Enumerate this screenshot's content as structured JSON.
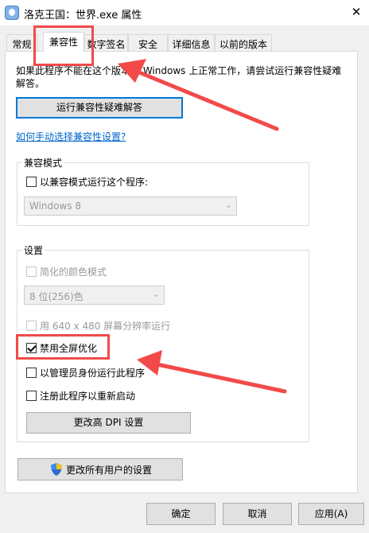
{
  "window": {
    "title": "洛克王国：世界.exe 属性",
    "close_glyph": "✕"
  },
  "tabs": [
    {
      "label": "常规"
    },
    {
      "label": "兼容性"
    },
    {
      "label": "数字签名"
    },
    {
      "label": "安全"
    },
    {
      "label": "详细信息"
    },
    {
      "label": "以前的版本"
    }
  ],
  "compat": {
    "description": "如果此程序不能在这个版本的 Windows 上正常工作，请尝试运行兼容性疑难解答。",
    "troubleshoot_button": "运行兼容性疑难解答",
    "manual_link": "如何手动选择兼容性设置?",
    "mode_group": {
      "label": "兼容模式",
      "checkbox_label": "以兼容模式运行这个程序:",
      "checked": false,
      "os_select_value": "Windows 8"
    },
    "settings_group": {
      "label": "设置",
      "reduced_color": {
        "label": "简化的颜色模式",
        "checked": false,
        "disabled": true
      },
      "color_select_value": "8 位(256)色",
      "res_640": {
        "label": "用 640 x 480 屏幕分辨率运行",
        "checked": false,
        "disabled": true
      },
      "disable_fullscreen": {
        "label": "禁用全屏优化",
        "checked": true
      },
      "run_as_admin": {
        "label": "以管理员身份运行此程序",
        "checked": false
      },
      "register_restart": {
        "label": "注册此程序以重新启动",
        "checked": false
      },
      "dpi_button": "更改高 DPI 设置"
    },
    "all_users_button": "更改所有用户的设置"
  },
  "footer": {
    "ok": "确定",
    "cancel": "取消",
    "apply": "应用(A)"
  },
  "colors": {
    "annotation_red": "#f24a4a",
    "link_blue": "#0066cc",
    "focus_blue": "#0078d7"
  },
  "icons": [
    "app-icon",
    "close-icon",
    "uac-shield-icon",
    "dropdown-arrow-icon",
    "check-icon"
  ]
}
